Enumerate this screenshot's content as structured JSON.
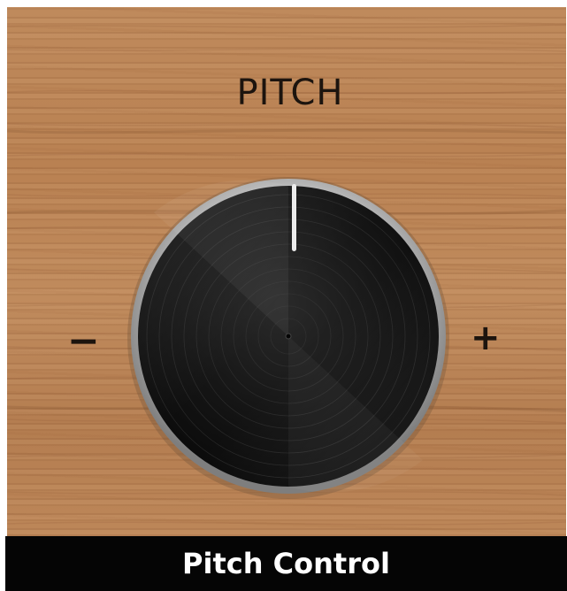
{
  "label": "PITCH",
  "scale": {
    "min_symbol": "−",
    "max_symbol": "+"
  },
  "knob": {
    "position_fraction": 0.5
  },
  "caption": "Pitch Control",
  "colors": {
    "wood": "#bf8a5c",
    "knob_face": "#141414",
    "knob_rim": "#c9c9c9",
    "caption_bg": "#050505",
    "caption_text": "#ffffff"
  }
}
